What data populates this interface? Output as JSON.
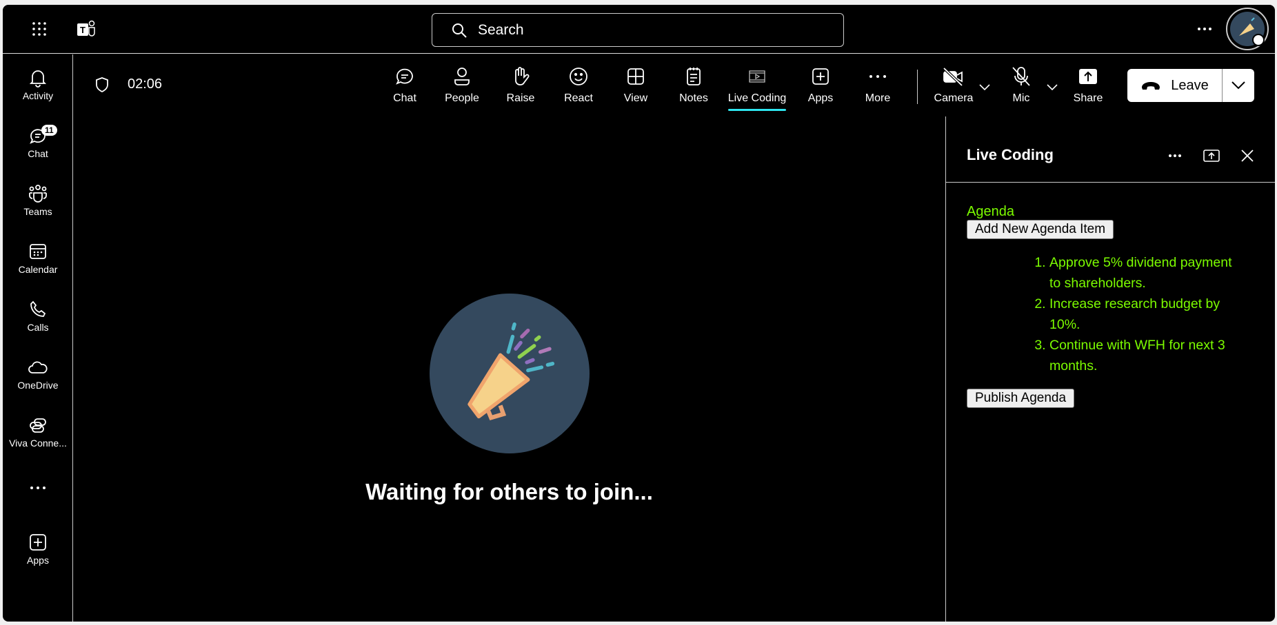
{
  "topbar": {
    "search_placeholder": "Search",
    "icons": [
      "app-launcher-icon",
      "teams-logo-icon",
      "search-icon",
      "more-icon",
      "avatar"
    ]
  },
  "rail": {
    "items": [
      {
        "label": "Activity",
        "icon": "bell-icon"
      },
      {
        "label": "Chat",
        "icon": "chat-icon",
        "badge": "11"
      },
      {
        "label": "Teams",
        "icon": "teams-icon"
      },
      {
        "label": "Calendar",
        "icon": "calendar-icon"
      },
      {
        "label": "Calls",
        "icon": "phone-icon"
      },
      {
        "label": "OneDrive",
        "icon": "cloud-icon"
      },
      {
        "label": "Viva Conne...",
        " icon": "viva-icon"
      },
      {
        "label": "Apps",
        "icon": "add-app-icon"
      }
    ]
  },
  "meeting": {
    "timer": "02:06",
    "tools": [
      {
        "label": "Chat"
      },
      {
        "label": "People"
      },
      {
        "label": "Raise"
      },
      {
        "label": "React"
      },
      {
        "label": "View"
      },
      {
        "label": "Notes"
      },
      {
        "label": "Live Coding",
        "active": true
      },
      {
        "label": "Apps"
      },
      {
        "label": "More"
      },
      {
        "label": "Camera"
      },
      {
        "label": "Mic"
      },
      {
        "label": "Share"
      }
    ],
    "leave_label": "Leave",
    "active_color": "#2ee6f0"
  },
  "stage": {
    "waiting_text": "Waiting for others to join..."
  },
  "panel": {
    "title": "Live Coding",
    "agenda_heading": "Agenda",
    "add_button": "Add New Agenda Item",
    "items": [
      "Approve 5% dividend payment to shareholders.",
      "Increase research budget by 10%.",
      "Continue with WFH for next 3 months."
    ],
    "publish_button": "Publish Agenda",
    "text_color": "#7cfc00"
  }
}
